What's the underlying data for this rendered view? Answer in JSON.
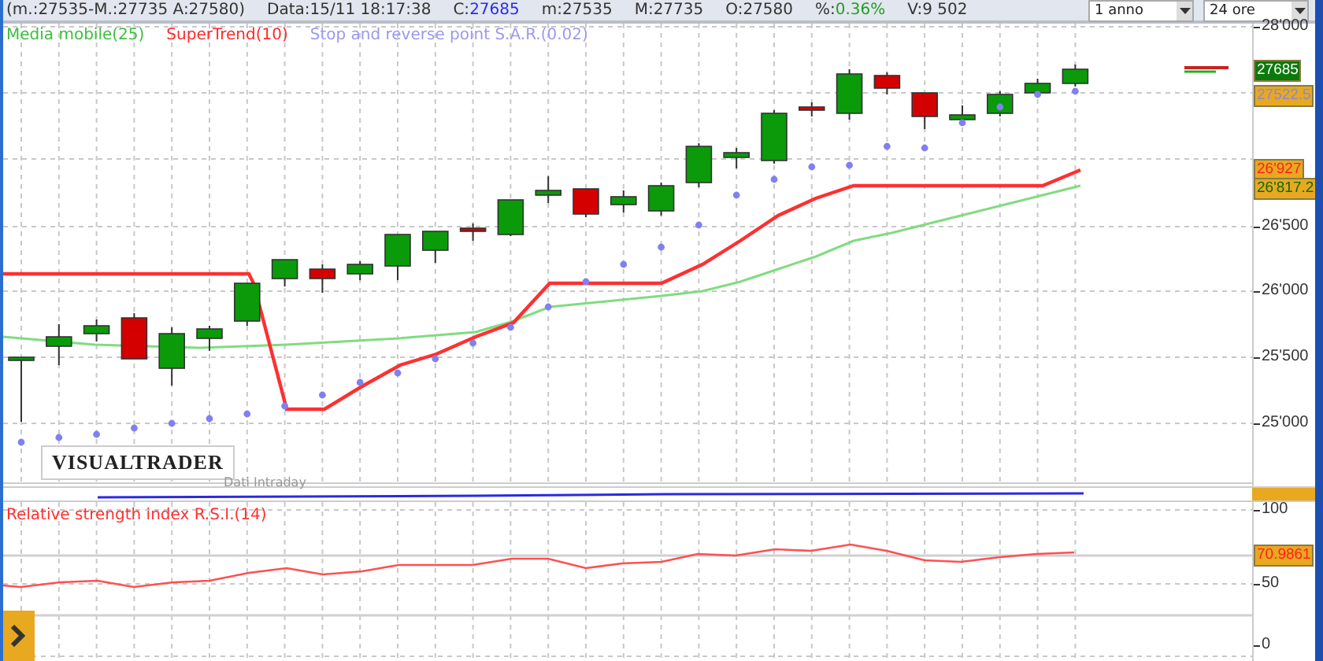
{
  "header": {
    "range": "(m.:27535-M.:27735 A:27580)",
    "stats": [
      {
        "label": "Data:",
        "value": "15/11 18:17:38",
        "kind": "plain"
      },
      {
        "label": "C:",
        "value": "27685",
        "kind": "price"
      },
      {
        "label": "m:",
        "value": "27535",
        "kind": "plain"
      },
      {
        "label": "M:",
        "value": "27735",
        "kind": "plain"
      },
      {
        "label": "O:",
        "value": "27580",
        "kind": "plain"
      },
      {
        "label": "%:",
        "value": "0.36%",
        "kind": "change"
      },
      {
        "label": "V:",
        "value": "9 502",
        "kind": "plain"
      }
    ],
    "selects": [
      {
        "value": "1 anno"
      },
      {
        "value": "24 ore"
      }
    ]
  },
  "legend": [
    {
      "text": "Media mobile(25)",
      "color": "#3cc03c"
    },
    {
      "text": "SuperTrend(10)",
      "color": "#ff2a2a"
    },
    {
      "text": "Stop and reverse point S.A.R.(0.02)",
      "color": "#9a9af0"
    }
  ],
  "price_axis": {
    "ticks": [
      "28'000",
      "26'500",
      "26'000",
      "25'500",
      "25'000"
    ],
    "tags": [
      {
        "text": "27685",
        "kind": "last"
      },
      {
        "text": "27522.5",
        "kind": "sar"
      },
      {
        "text": "26'927",
        "kind": "supertrend"
      },
      {
        "text": "26'817.2",
        "kind": "ma"
      }
    ]
  },
  "logo": "VISUALTRADER",
  "source": "Dati Intraday",
  "rsi": {
    "title": "Relative strength index R.S.I.(14)",
    "ticks": [
      "100",
      "50",
      "0"
    ],
    "value_tag": "70.9861"
  }
}
